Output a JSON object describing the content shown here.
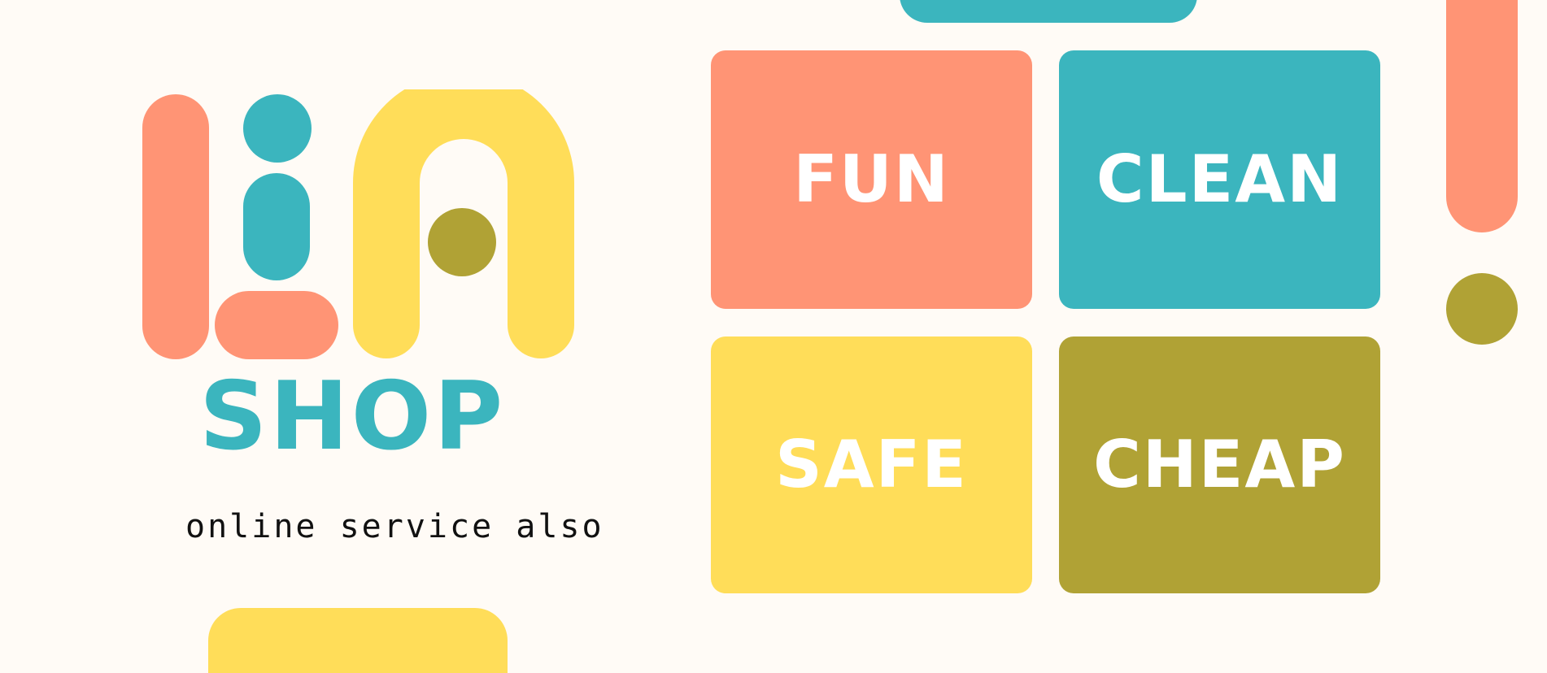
{
  "colors": {
    "background": "#fffbf6",
    "coral": "#ff9475",
    "teal": "#3bb5be",
    "yellow": "#ffdd59",
    "olive": "#b0a235",
    "white": "#ffffff",
    "text": "#111111"
  },
  "logo": {
    "word": "SHOP",
    "tagline": "online service also"
  },
  "tiles": [
    {
      "label": "FUN",
      "color": "#ff9475"
    },
    {
      "label": "CLEAN",
      "color": "#3bb5be"
    },
    {
      "label": "SAFE",
      "color": "#ffdd59"
    },
    {
      "label": "CHEAP",
      "color": "#b0a235"
    }
  ]
}
